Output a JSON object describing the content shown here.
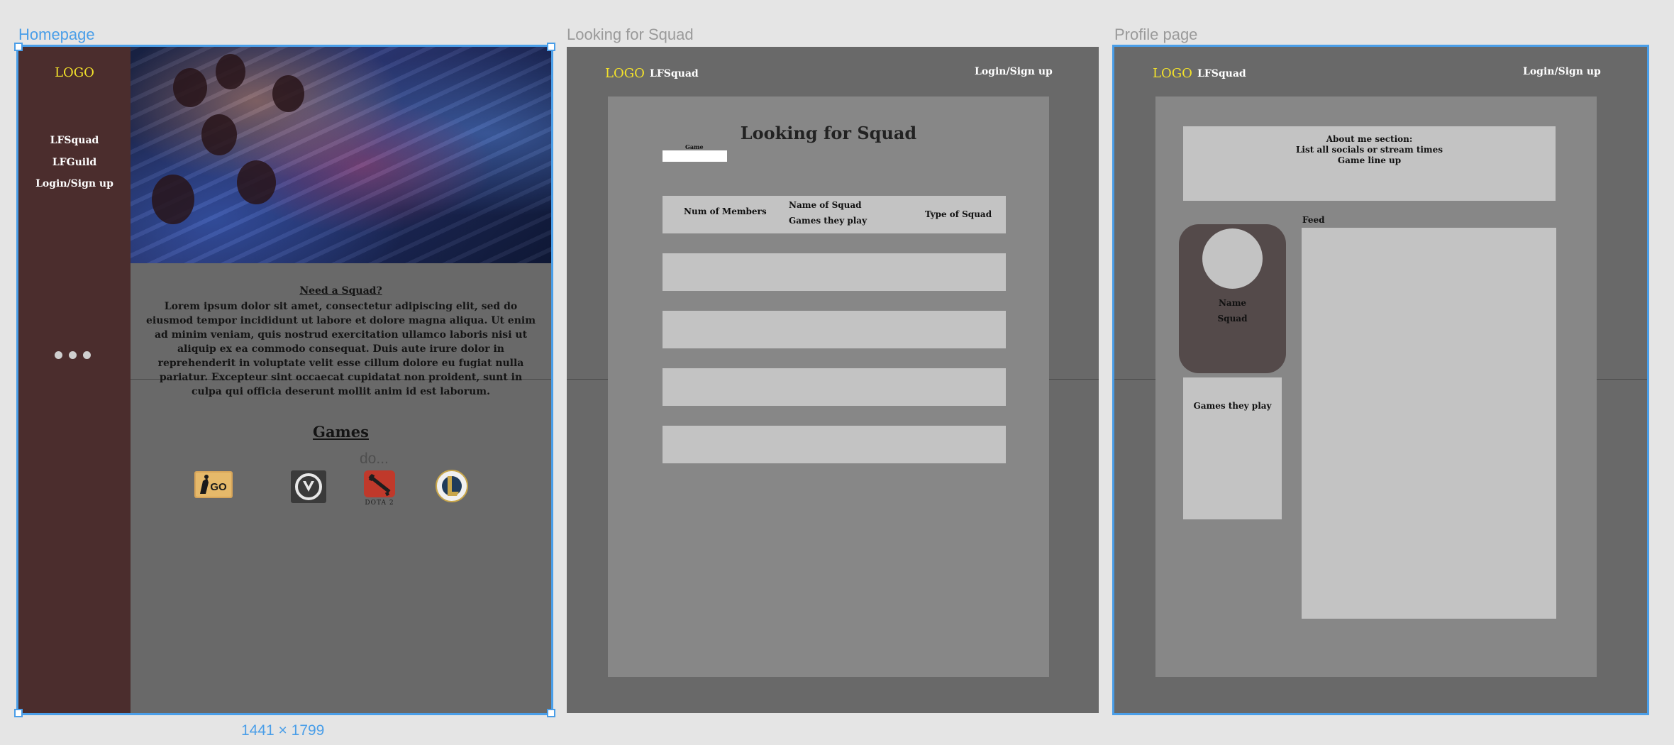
{
  "frames": {
    "homepage": {
      "label": "Homepage"
    },
    "lfs": {
      "label": "Looking for Squad"
    },
    "profile": {
      "label": "Profile page"
    }
  },
  "selection": {
    "size": "1441 × 1799",
    "accent": "#4a9ee8"
  },
  "homepage": {
    "logo": "LOGO",
    "nav": [
      "LFSquad",
      "LFGuild",
      "Login/Sign up"
    ],
    "hero_image": "esports-players-at-computers",
    "heading": "Need a Squad?",
    "body": "Lorem ipsum dolor sit amet, consectetur adipiscing elit, sed do eiusmod tempor incididunt ut labore et dolore magna aliqua. Ut enim ad minim veniam, quis nostrud exercitation ullamco laboris nisi ut aliquip ex ea commodo consequat. Duis aute irure dolor in reprehenderit in voluptate velit esse cillum dolore eu fugiat nulla pariatur. Excepteur sint occaecat cupidatat non proident, sunt in culpa qui officia deserunt mollit anim id est laborum.",
    "games_title": "Games",
    "games_overflow": "do...",
    "games": [
      "csgo-icon",
      "overwatch-icon",
      "dota2-icon",
      "league-of-legends-icon"
    ],
    "dota_caption": "DOTA 2"
  },
  "lfs": {
    "logo": "LOGO",
    "site": "LFSquad",
    "login": "Login/Sign up",
    "title": "Looking for Squad",
    "game_label": "Game",
    "game_value": "",
    "columns": {
      "members": "Num of Members",
      "name": "Name of Squad",
      "games": "Games they play",
      "type": "Type of Squad"
    }
  },
  "profile": {
    "logo": "LOGO",
    "site": "LFSquad",
    "login": "Login/Sign up",
    "about": [
      "About me section:",
      "List all socials or stream times",
      "Game line up"
    ],
    "name": "Name",
    "squad": "Squad",
    "games_they_play": "Games they play",
    "feed": "Feed"
  },
  "colors": {
    "logo": "#f3e22b",
    "sidebar": "#4b2d2d",
    "frame": "#696969",
    "panel": "#878787",
    "placeholder": "#c3c3c3"
  }
}
